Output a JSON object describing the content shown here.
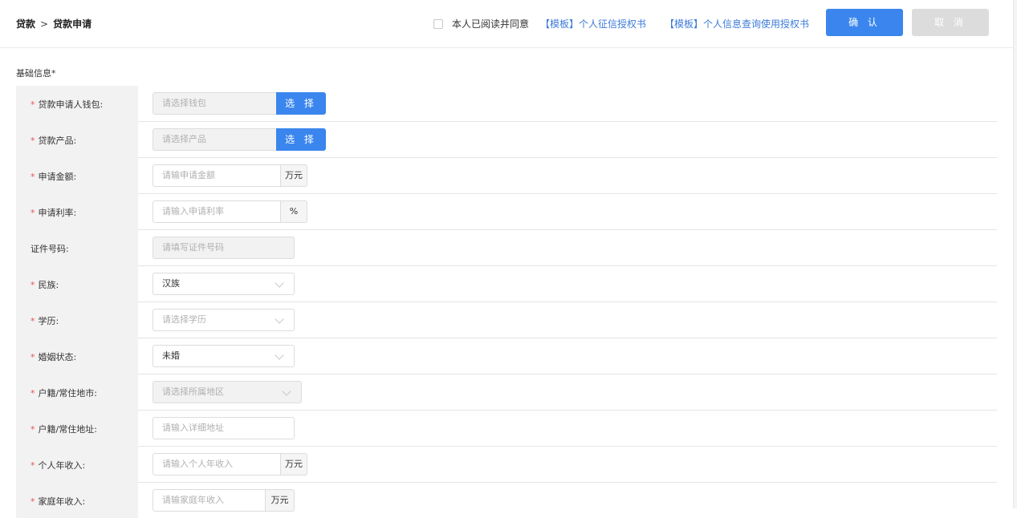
{
  "header": {
    "breadcrumb_root": "贷款",
    "breadcrumb_sep": ">",
    "breadcrumb_current": "贷款申请",
    "agree_text": "本人已阅读并同意",
    "link_credit": "【模板】个人征信授权书",
    "link_info": "【模板】个人信息查询使用授权书",
    "confirm_label": "确 认",
    "cancel_label": "取 消"
  },
  "section": {
    "title": "基础信息*"
  },
  "form": {
    "required_mark": "*",
    "wallet": {
      "label": "贷款申请人钱包:",
      "placeholder": "请选择钱包",
      "button": "选 择"
    },
    "product": {
      "label": "贷款产品:",
      "placeholder": "请选择产品",
      "button": "选 择"
    },
    "amount": {
      "label": "申请金额:",
      "placeholder": "请输申请金额",
      "unit": "万元"
    },
    "rate": {
      "label": "申请利率:",
      "placeholder": "请输入申请利率",
      "unit": "%"
    },
    "id_number": {
      "label": "证件号码:",
      "placeholder": "请填写证件号码"
    },
    "ethnicity": {
      "label": "民族:",
      "value": "汉族"
    },
    "education": {
      "label": "学历:",
      "placeholder": "请选择学历"
    },
    "marital": {
      "label": "婚姻状态:",
      "value": "未婚"
    },
    "city": {
      "label": "户籍/常住地市:",
      "placeholder": "请选择所属地区"
    },
    "address": {
      "label": "户籍/常住地址:",
      "placeholder": "请输入详细地址"
    },
    "personal_income": {
      "label": "个人年收入:",
      "placeholder": "请输入个人年收入",
      "unit": "万元"
    },
    "family_income": {
      "label": "家庭年收入:",
      "placeholder": "请输家庭年收入",
      "unit": "万元"
    }
  },
  "colors": {
    "accent": "#3a86ee",
    "required": "#e85555",
    "link": "#3d7bd9"
  }
}
